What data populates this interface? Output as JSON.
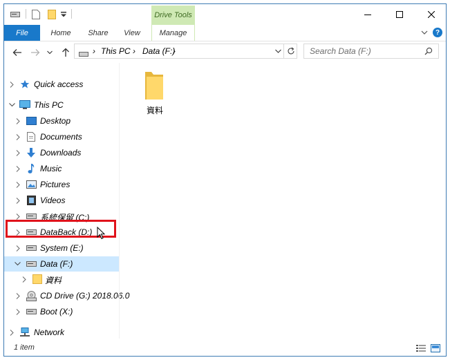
{
  "titlebar": {
    "contextual_tab": "Drive Tools",
    "minimize": "—",
    "maximize": "☐",
    "close": "✕"
  },
  "ribbon": {
    "tabs": [
      "File",
      "Home",
      "Share",
      "View",
      "Manage"
    ]
  },
  "address": {
    "path": [
      "This PC",
      "Data (F:)"
    ],
    "search_placeholder": "Search Data (F:)"
  },
  "nav": {
    "items": [
      {
        "label": "Quick access",
        "icon": "star-icon"
      },
      {
        "label": "This PC",
        "icon": "computer-icon"
      },
      {
        "label": "Desktop",
        "icon": "desktop-icon"
      },
      {
        "label": "Documents",
        "icon": "documents-icon"
      },
      {
        "label": "Downloads",
        "icon": "download-icon"
      },
      {
        "label": "Music",
        "icon": "music-icon"
      },
      {
        "label": "Pictures",
        "icon": "pictures-icon"
      },
      {
        "label": "Videos",
        "icon": "videos-icon"
      },
      {
        "label": "系統保留 (C:)",
        "icon": "drive-icon"
      },
      {
        "label": "DataBack (D:)",
        "icon": "drive-icon"
      },
      {
        "label": "System (E:)",
        "icon": "drive-icon"
      },
      {
        "label": "Data (F:)",
        "icon": "drive-icon"
      },
      {
        "label": "資料",
        "icon": "folder-icon"
      },
      {
        "label": "CD Drive (G:) 2018.06.0",
        "icon": "cd-drive-icon"
      },
      {
        "label": "Boot (X:)",
        "icon": "drive-icon"
      },
      {
        "label": "Network",
        "icon": "network-icon"
      }
    ]
  },
  "content": {
    "items": [
      {
        "label": "資料",
        "icon": "folder-icon"
      }
    ]
  },
  "status": {
    "count": "1 item"
  },
  "colors": {
    "accent": "#1979ca",
    "selection": "#cce8ff",
    "drive_tools": "#cfe9b4",
    "highlight": "#e0121b",
    "folder": "#ffd86b"
  }
}
